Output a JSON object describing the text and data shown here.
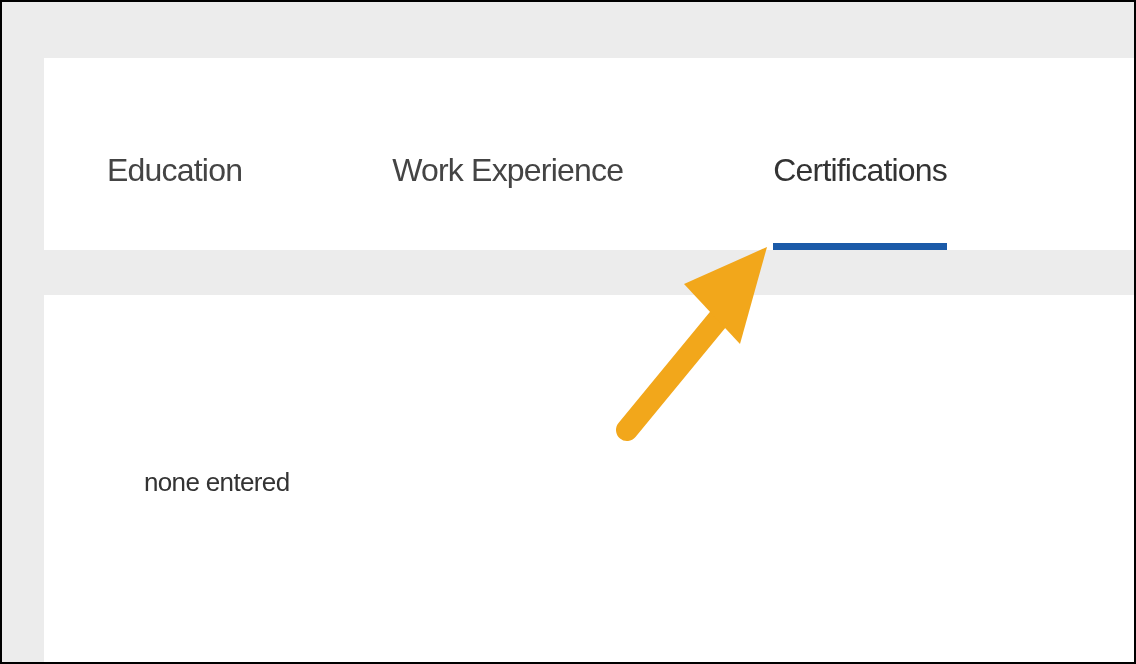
{
  "tabs": [
    {
      "label": "Education",
      "selected": false
    },
    {
      "label": "Work Experience",
      "selected": false
    },
    {
      "label": "Certifications",
      "selected": true
    }
  ],
  "panel": {
    "text": "none entered"
  }
}
